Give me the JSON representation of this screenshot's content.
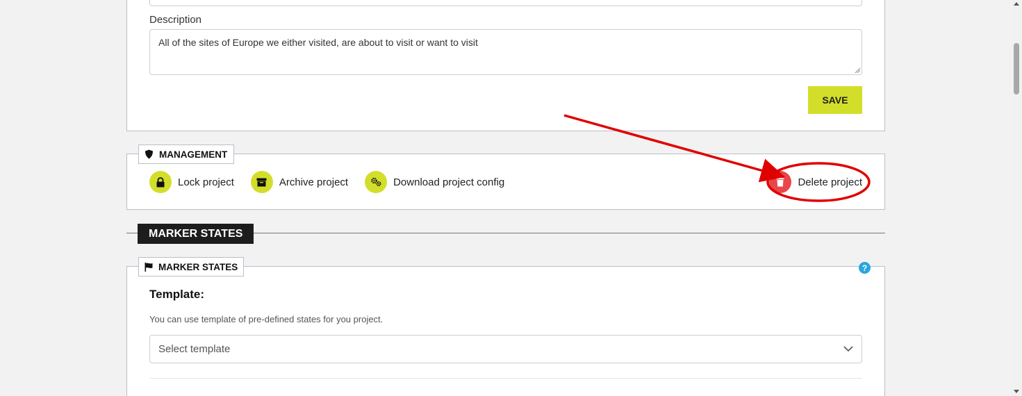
{
  "project_form": {
    "description_label": "Description",
    "description_value": "All of the sites of Europe we either visited, are about to visit or want to visit",
    "save_label": "SAVE"
  },
  "management": {
    "title": "MANAGEMENT",
    "title_icon": "shield-icon",
    "actions": [
      {
        "label": "Lock project",
        "icon": "lock-icon"
      },
      {
        "label": "Archive project",
        "icon": "archive-icon"
      },
      {
        "label": "Download project config",
        "icon": "gears-icon"
      }
    ],
    "delete": {
      "label": "Delete project",
      "icon": "trash-icon"
    }
  },
  "marker_states_section": {
    "heading": "MARKER STATES",
    "panel_title": "MARKER STATES",
    "panel_icon": "flag-icon",
    "help": "?",
    "template_title": "Template:",
    "template_hint": "You can use template of pre-defined states for you project.",
    "select_placeholder": "Select template"
  },
  "colors": {
    "accent": "#d3de2a",
    "danger": "#ea4548",
    "dark": "#1d1d1d",
    "help": "#2aa5e0",
    "annotation": "#e00000"
  }
}
